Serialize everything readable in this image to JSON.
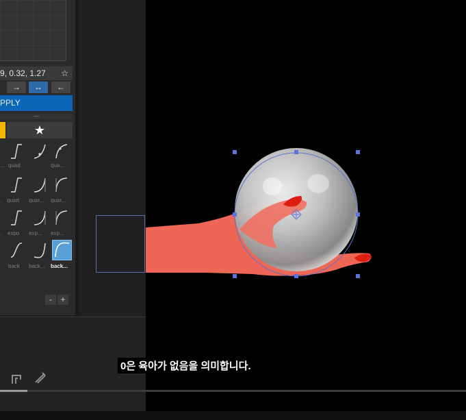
{
  "easing_panel": {
    "values_text": "9, 0.32, 1.27",
    "favorite_icon": "star-outline-icon",
    "directions": [
      "→",
      "↔",
      "←"
    ],
    "apply_label": "PPLY",
    "collapse_glyph": "—",
    "favorites_tab_icon": "star-icon",
    "labels_row1": [
      "...",
      "quad",
      "qua..."
    ],
    "labels_row2": [
      ".",
      "quart",
      "quar...",
      "quar..."
    ],
    "labels_row3": [
      ".",
      "expo",
      "exp...",
      "exp..."
    ],
    "labels_row4": [
      ".",
      "back",
      "back...",
      "back..."
    ],
    "minus_label": "-",
    "plus_label": "+"
  },
  "subtitle": "0은 육아가 없음을 의미합니다.",
  "colors": {
    "accent": "#0b66b5",
    "favorite_tab": "#f2b705",
    "selection_handle": "#5b73d6",
    "hand": "#ee6655",
    "nail": "#dd1f10"
  },
  "timeline": {
    "progress": 0.06
  }
}
